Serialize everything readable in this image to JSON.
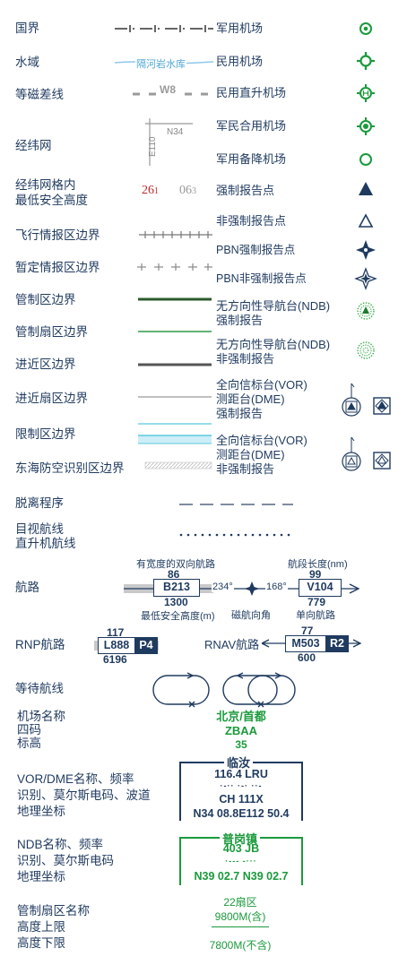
{
  "left": {
    "boundary": "国界",
    "water": "水域",
    "water_label": "隔河岩水库",
    "isogonic": "等磁差线",
    "isogonic_label": "W8",
    "grid": "经纬网",
    "grid_n": "N34",
    "grid_e": "E110",
    "grid_alt_1": "经纬网格内",
    "grid_alt_2": "最低安全高度",
    "alt_red_a": "26",
    "alt_red_b": "1",
    "alt_grey_a": "06",
    "alt_grey_b": "3",
    "fir": "飞行情报区边界",
    "tfir": "暂定情报区边界",
    "ctl": "管制区边界",
    "ctl_sector": "管制扇区边界",
    "approach": "进近区边界",
    "approach_sector": "进近扇区边界",
    "restricted": "限制区边界",
    "adiz": "东海防空识别区边界",
    "departure": "脱离程序",
    "visual_1": "目视航线",
    "visual_2": "直升机航线",
    "route": "航路",
    "rnp": "RNP航路",
    "rnav": "RNAV航路",
    "holding": "等待航线",
    "ap_1": "机场名称",
    "ap_2": "四码",
    "ap_3": "标高",
    "vor_1": "VOR/DME名称、频率",
    "vor_2": "识别、莫尔斯电码、波道",
    "vor_3": "地理坐标",
    "ndb_1": "NDB名称、频率",
    "ndb_2": "识别、莫尔斯电码",
    "ndb_3": "地理坐标",
    "sec_1": "管制扇区名称",
    "sec_2": "高度上限",
    "sec_3": "高度下限"
  },
  "right": {
    "military": "军用机场",
    "civil": "民用机场",
    "civil_heli": "民用直升机场",
    "joint": "军民合用机场",
    "mil_alt": "军用备降机场",
    "compulsory": "强制报告点",
    "noncompulsory": "非强制报告点",
    "pbn_comp": "PBN强制报告点",
    "pbn_noncomp": "PBN非强制报告点",
    "ndb_comp_1": "无方向性导航台(NDB)",
    "ndb_comp_2": "强制报告",
    "ndb_non_1": "无方向性导航台(NDB)",
    "ndb_non_2": "非强制报告",
    "vor_comp_1": "全向信标台(VOR)",
    "vor_comp_2": "测距台(DME)",
    "vor_comp_3": "强制报告",
    "vor_non_1": "全向信标台(VOR)",
    "vor_non_2": "测距台(DME)",
    "vor_non_3": "非强制报告"
  },
  "route_sample": {
    "two_way": "有宽度的双向航路",
    "width": "86",
    "ident": "B213",
    "msa": "1300",
    "msa_label": "最低安全高度(m)",
    "bearing_a": "234°",
    "bearing_b": "168°",
    "mag_label": "磁航向角",
    "seg_label": "航段长度(nm)",
    "seg_len": "99",
    "ident2": "V104",
    "alt2": "779",
    "oneway_label": "单向航路"
  },
  "rnp_sample": {
    "top": "117",
    "ident": "L888",
    "tag": "P4",
    "bottom": "6196"
  },
  "rnav_sample": {
    "top": "77",
    "ident": "M503",
    "tag": "R2",
    "bottom": "600"
  },
  "airport": {
    "name": "北京/首都",
    "code": "ZBAA",
    "elev": "35"
  },
  "vor_box": {
    "name": "临汝",
    "freq": "116.4 LRU",
    "morse": "·-·· ·-· ··-",
    "channel": "CH 111X",
    "coord": "N34 08.8E112 50.4"
  },
  "ndb_box": {
    "name": "普岗镇",
    "freq": "403 JB",
    "morse": "·--- -···",
    "coord": "N39 02.7 N39 02.7"
  },
  "sector": {
    "name": "22扇区",
    "upper": "9800M(含)",
    "lower": "7800M(不含)"
  },
  "colors": {
    "navy": "#1f3a5f",
    "green": "#1a9a3c",
    "red": "#c0282d",
    "grey": "#8a8a8a",
    "cyan": "#5bc8de"
  }
}
